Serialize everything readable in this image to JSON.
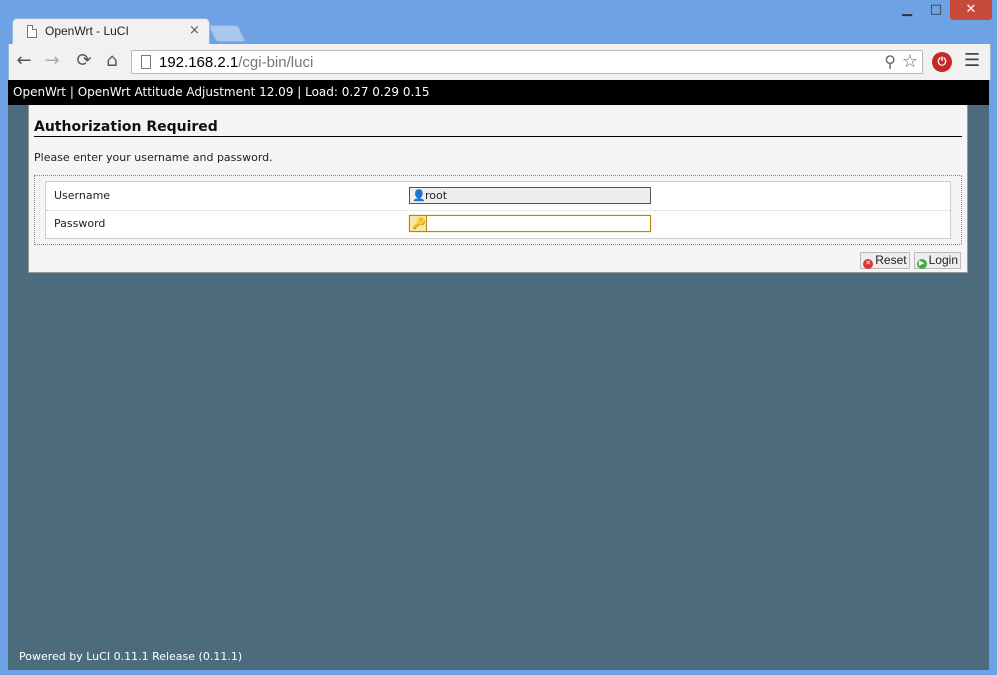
{
  "browser": {
    "tab_title": "OpenWrt - LuCI",
    "close_tab": "×",
    "window_controls": {
      "minimize": "▁",
      "maximize": "□",
      "close": "✕"
    },
    "url_host": "192.168.2.1",
    "url_path": "/cgi-bin/luci",
    "nav": {
      "back": "←",
      "forward": "→",
      "reload": "⟳",
      "home": "⌂"
    },
    "icons": {
      "zoom": "🔍",
      "star": "☆",
      "extension": "⏻",
      "menu": "☰"
    }
  },
  "page": {
    "topbar_text": "OpenWrt | OpenWrt Attitude Adjustment 12.09 | Load: 0.27 0.29 0.15",
    "title": "Authorization Required",
    "description": "Please enter your username and password.",
    "fields": [
      {
        "label": "Username",
        "value": "root"
      },
      {
        "label": "Password",
        "value": ""
      }
    ],
    "buttons": {
      "reset": "Reset",
      "login": "Login"
    },
    "footer": "Powered by LuCI 0.11.1 Release (0.11.1)"
  },
  "colors": {
    "frame": "#6da2e5",
    "page_background": "#4c6b7d",
    "topbar": "#000000",
    "panel": "#f5f5f5",
    "focus_border": "#b8860b"
  }
}
